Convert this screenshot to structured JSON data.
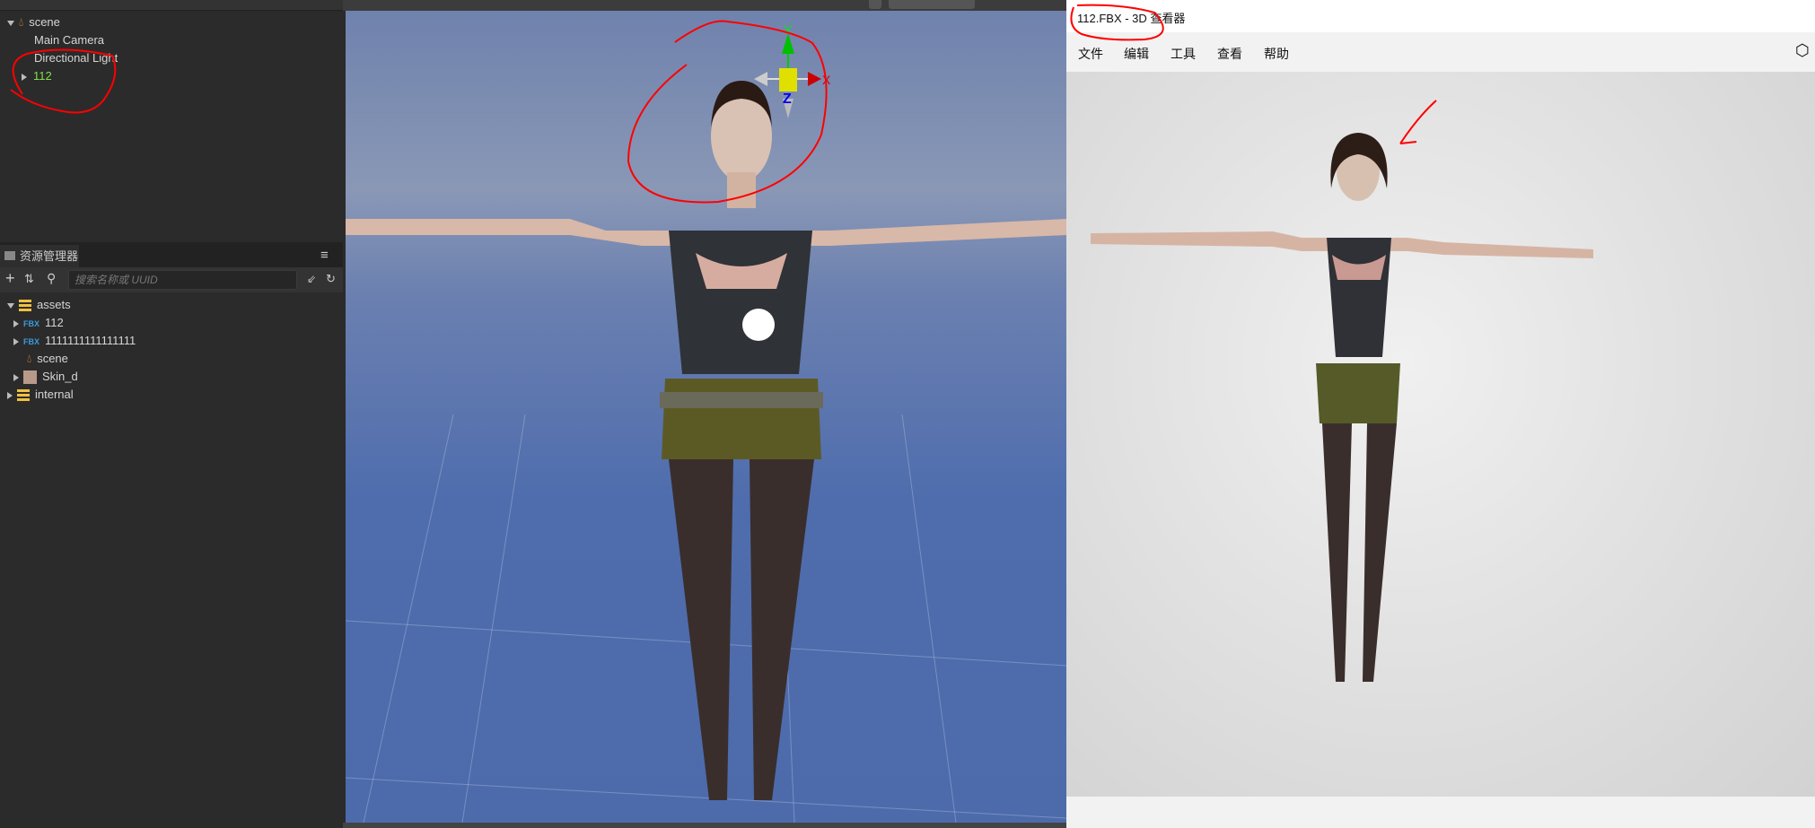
{
  "hierarchy": {
    "items": [
      {
        "label": "scene",
        "icon": "scene-icon",
        "expanded": true
      },
      {
        "label": "Main Camera"
      },
      {
        "label": "Directional Light"
      },
      {
        "label": "112",
        "color": "#7ee04a",
        "expanded": false
      }
    ]
  },
  "assets_panel": {
    "title": "资源管理器",
    "search_placeholder": "搜索名称或 UUID",
    "tree": [
      {
        "label": "assets",
        "icon": "database-icon",
        "expanded": true
      },
      {
        "label": "112",
        "icon": "fbx-icon",
        "badge": "FBX"
      },
      {
        "label": "1111111111111111",
        "icon": "fbx-icon",
        "badge": "FBX"
      },
      {
        "label": "scene",
        "icon": "scene-icon"
      },
      {
        "label": "Skin_d",
        "icon": "texture-thumbnail"
      },
      {
        "label": "internal",
        "icon": "database-icon"
      }
    ]
  },
  "viewport": {
    "gizmo": {
      "x": "X",
      "y": "Y",
      "z": "Z"
    }
  },
  "viewer": {
    "title": "112.FBX - 3D 查看器",
    "menu": [
      "文件",
      "编辑",
      "工具",
      "查看",
      "帮助"
    ]
  },
  "colors": {
    "annotation": "#ff0000",
    "selected_node": "#7ee04a"
  }
}
